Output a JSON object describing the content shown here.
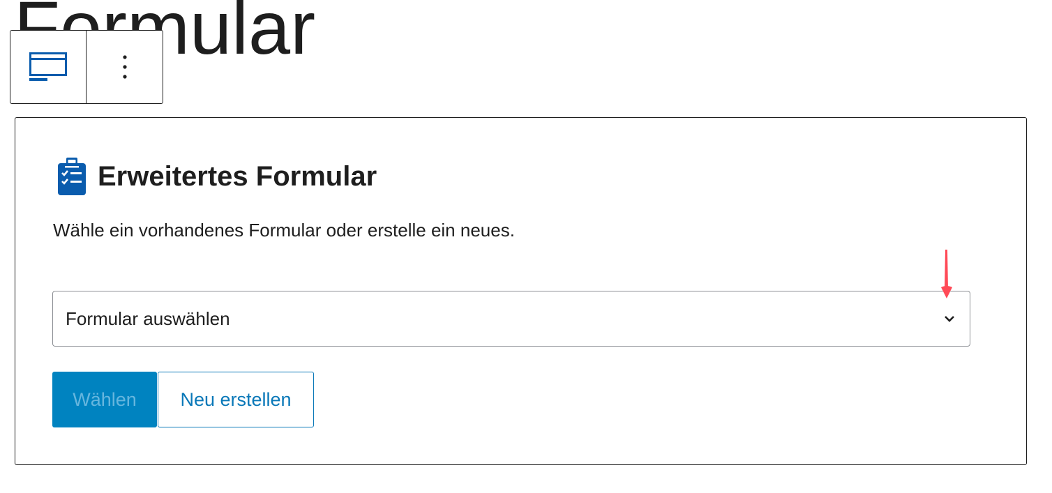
{
  "page": {
    "title": "Formular"
  },
  "toolbar": {
    "block_type_icon": "form-block-icon",
    "options_icon": "more-vertical-icon"
  },
  "block": {
    "icon": "clipboard-checklist-icon",
    "title": "Erweitertes Formular",
    "instructions": "Wähle ein vorhandenes Formular oder erstelle ein neues.",
    "select": {
      "value": "Formular auswählen",
      "icon": "chevron-down-icon"
    },
    "buttons": {
      "choose_label": "Wählen",
      "create_label": "Neu erstellen"
    }
  },
  "annotation": {
    "icon": "red-arrow-down-icon",
    "color": "#ff4a57"
  },
  "colors": {
    "accent": "#0083c0",
    "accent_text": "#0a78b8",
    "icon_blue": "#0a5cad",
    "border": "#1e1e1e"
  }
}
